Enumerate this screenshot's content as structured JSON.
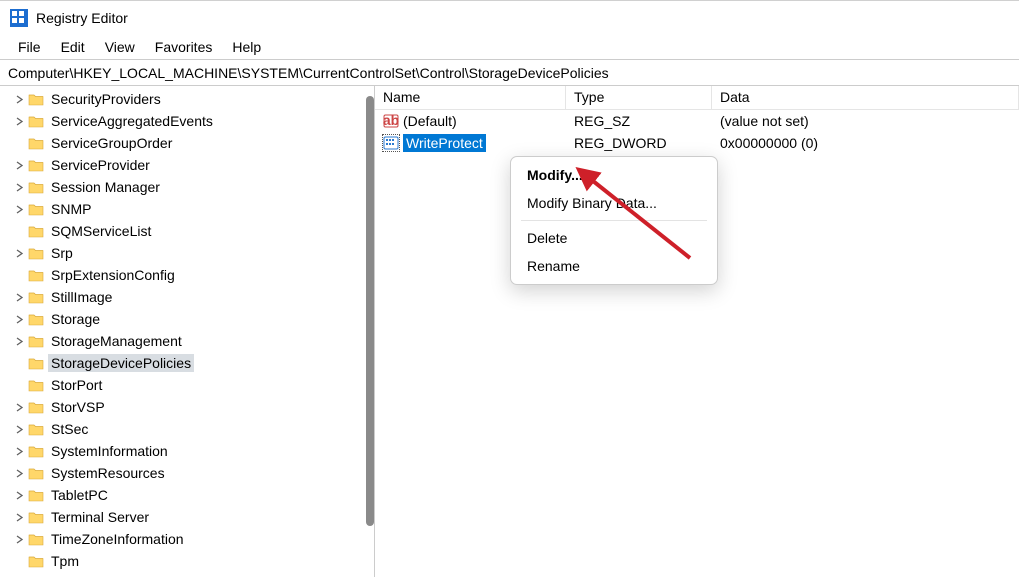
{
  "title": "Registry Editor",
  "menu": {
    "file": "File",
    "edit": "Edit",
    "view": "View",
    "favorites": "Favorites",
    "help": "Help"
  },
  "address": "Computer\\HKEY_LOCAL_MACHINE\\SYSTEM\\CurrentControlSet\\Control\\StorageDevicePolicies",
  "tree": [
    {
      "label": "SecurityProviders",
      "expandable": true,
      "selected": false
    },
    {
      "label": "ServiceAggregatedEvents",
      "expandable": true,
      "selected": false
    },
    {
      "label": "ServiceGroupOrder",
      "expandable": false,
      "selected": false
    },
    {
      "label": "ServiceProvider",
      "expandable": true,
      "selected": false
    },
    {
      "label": "Session Manager",
      "expandable": true,
      "selected": false
    },
    {
      "label": "SNMP",
      "expandable": true,
      "selected": false
    },
    {
      "label": "SQMServiceList",
      "expandable": false,
      "selected": false
    },
    {
      "label": "Srp",
      "expandable": true,
      "selected": false
    },
    {
      "label": "SrpExtensionConfig",
      "expandable": false,
      "selected": false
    },
    {
      "label": "StillImage",
      "expandable": true,
      "selected": false
    },
    {
      "label": "Storage",
      "expandable": true,
      "selected": false
    },
    {
      "label": "StorageManagement",
      "expandable": true,
      "selected": false
    },
    {
      "label": "StorageDevicePolicies",
      "expandable": false,
      "selected": true
    },
    {
      "label": "StorPort",
      "expandable": false,
      "selected": false
    },
    {
      "label": "StorVSP",
      "expandable": true,
      "selected": false
    },
    {
      "label": "StSec",
      "expandable": true,
      "selected": false
    },
    {
      "label": "SystemInformation",
      "expandable": true,
      "selected": false
    },
    {
      "label": "SystemResources",
      "expandable": true,
      "selected": false
    },
    {
      "label": "TabletPC",
      "expandable": true,
      "selected": false
    },
    {
      "label": "Terminal Server",
      "expandable": true,
      "selected": false
    },
    {
      "label": "TimeZoneInformation",
      "expandable": true,
      "selected": false
    },
    {
      "label": "Tpm",
      "expandable": false,
      "selected": false
    }
  ],
  "columns": {
    "name": "Name",
    "type": "Type",
    "data": "Data"
  },
  "values": [
    {
      "name": "(Default)",
      "type": "REG_SZ",
      "data": "(value not set)",
      "icon": "sz",
      "selected": false
    },
    {
      "name": "WriteProtect",
      "type": "REG_DWORD",
      "data": "0x00000000 (0)",
      "icon": "dw",
      "selected": true
    }
  ],
  "context_menu": {
    "modify": "Modify...",
    "modify_binary": "Modify Binary Data...",
    "delete": "Delete",
    "rename": "Rename"
  }
}
